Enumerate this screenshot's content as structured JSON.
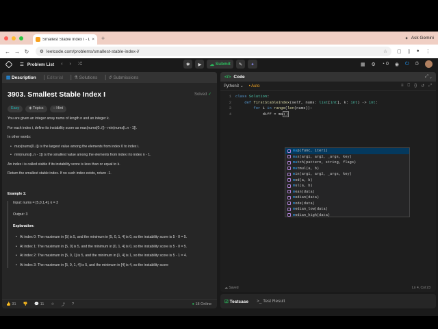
{
  "browser": {
    "tab_title": "Smallest Stable Index I - Lee...",
    "new_tab": "+",
    "ask": "Ask Gemini",
    "url": "leetcode.com/problems/smallest-stable-index-i/"
  },
  "nav": {
    "problem_list": "Problem List",
    "submit": "Submit"
  },
  "left_tabs": [
    "Description",
    "Editorial",
    "Solutions",
    "Submissions"
  ],
  "problem": {
    "title": "3903. Smallest Stable Index I",
    "status": "Solved",
    "difficulty": "Easy",
    "topics": "Topics",
    "hint": "Hint",
    "p1": "You are given an integer array nums of length n and an integer k.",
    "p2": "For each index i, define its instability score as max(nums[0..i]) - min(nums[i..n - 1]).",
    "p3": "In other words:",
    "b1": "max(nums[0..i]) is the largest value among the elements from index 0 to index i.",
    "b2": "min(nums[i..n - 1]) is the smallest value among the elements from index i to index n - 1.",
    "p4": "An index i is called stable if its instability score is less than or equal to k.",
    "p5": "Return the smallest stable index. If no such index exists, return -1.",
    "example_title": "Example 1:",
    "input": "Input: nums = [5,0,1,4], k = 3",
    "output": "Output: 3",
    "explanation": "Explanation:",
    "e1": "At index 0: The maximum in [5] is 5, and the minimum in [5, 0, 1, 4] is 0, so the instability score is 5 - 0 = 5.",
    "e2": "At index 1: The maximum in [5, 0] is 5, and the minimum in [0, 1, 4] is 0, so the instability score is 5 - 0 = 5.",
    "e3": "At index 2: The maximum in [5, 0, 1] is 5, and the minimum in [1, 4] is 1, so the instability score is 5 - 1 = 4.",
    "e4": "At index 3: The maximum in [5, 0, 1, 4] is 5, and the minimum in [4] is 4, so the instability score"
  },
  "footer": {
    "likes": "31",
    "comments": "11",
    "online": "18 Online"
  },
  "code": {
    "title": "Code",
    "language": "Python3",
    "auto": "Auto",
    "saved": "Saved",
    "position": "Ln 4, Col 23",
    "lines": [
      "1",
      "2",
      "3",
      "4"
    ],
    "autocomplete": [
      {
        "hl": "ma",
        "rest": "p(func, iter1)"
      },
      {
        "hl": "ma",
        "rest": "x(arg1, arg2, _args, key)"
      },
      {
        "hl": "ma",
        "rest": "tch(pattern, string, flags)"
      },
      {
        "hl": "ma",
        "rest": "tmul(a, b)"
      },
      {
        "hl": "m",
        "rest": "in(arg1, arg2, _args, key)"
      },
      {
        "hl": "m",
        "rest": "od(a, b)"
      },
      {
        "hl": "m",
        "rest": "ul(a, b)"
      },
      {
        "hl": "m",
        "rest": "ean(data)"
      },
      {
        "hl": "m",
        "rest": "edian(data)"
      },
      {
        "hl": "m",
        "rest": "ode(data)"
      },
      {
        "hl": "m",
        "rest": "edian_low(data)"
      },
      {
        "hl": "m",
        "rest": "edian_high(data)"
      }
    ]
  },
  "tests": {
    "testcase": "Testcase",
    "result": "Test Result"
  }
}
